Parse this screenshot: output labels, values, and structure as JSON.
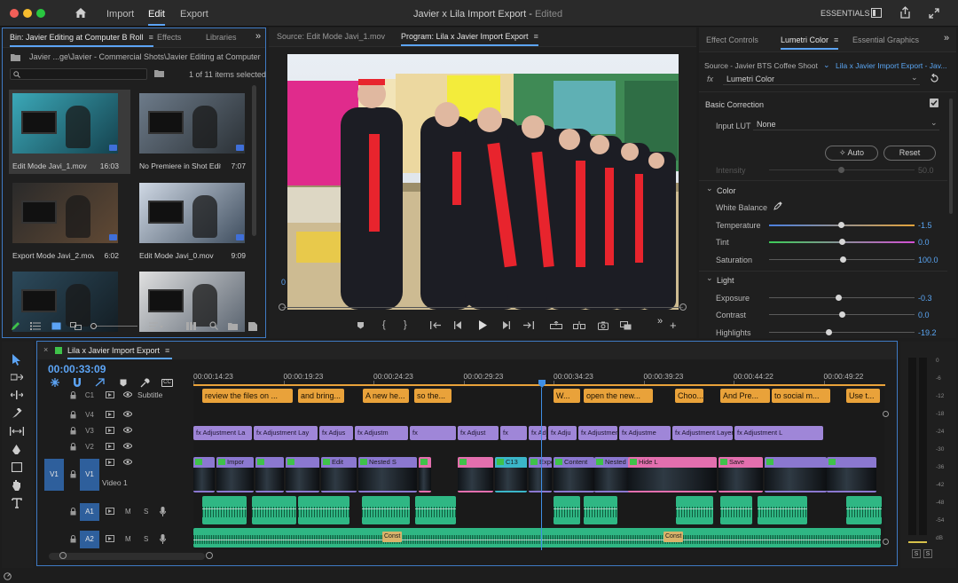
{
  "app": {
    "window_title": "Javier x Lila Import Export",
    "edited_state": "Edited",
    "nav": [
      "Import",
      "Edit",
      "Export"
    ],
    "active_nav": "Edit",
    "workspace": "ESSENTIALS"
  },
  "project_panel": {
    "tabs": [
      "Bin: Javier Editing at Computer B Roll",
      "Effects",
      "Libraries"
    ],
    "path": "Javier ...ge\\Javier - Commercial Shots\\Javier Editing at Computer B Roll",
    "search_placeholder": "",
    "selection_count": "1 of 11 items selected",
    "items": [
      {
        "name": "Edit Mode Javi_1.mov",
        "duration": "16:03",
        "selected": true
      },
      {
        "name": "No Premiere in Shot Editi...",
        "duration": "7:07",
        "selected": false
      },
      {
        "name": "Export Mode Javi_2.mov",
        "duration": "6:02",
        "selected": false
      },
      {
        "name": "Edit Mode Javi_0.mov",
        "duration": "9:09",
        "selected": false
      },
      {
        "name": "",
        "duration": "",
        "selected": false
      },
      {
        "name": "",
        "duration": "",
        "selected": false
      }
    ]
  },
  "source_monitor": {
    "tab": "Source: Edit Mode Javi_1.mov"
  },
  "program_monitor": {
    "tab": "Program: Lila x Javier Import Export",
    "partial_label": "0"
  },
  "effect_panel": {
    "tabs": [
      "Effect Controls",
      "Lumetri Color",
      "Essential Graphics"
    ],
    "active_tab": "Lumetri Color",
    "source": "Source - Javier BTS Coffee Shoot...",
    "target": "Lila x Javier Import Export - Jav...",
    "effect": "Lumetri Color",
    "basic_correction": "Basic Correction",
    "input_lut_label": "Input LUT",
    "input_lut_value": "None",
    "auto_label": "Auto",
    "reset_label": "Reset",
    "intensity": {
      "label": "Intensity",
      "value": "50.0"
    },
    "color_section": "Color",
    "white_balance": "White Balance",
    "temperature": {
      "label": "Temperature",
      "value": "-1.5"
    },
    "tint": {
      "label": "Tint",
      "value": "0.0"
    },
    "saturation": {
      "label": "Saturation",
      "value": "100.0"
    },
    "light_section": "Light",
    "exposure": {
      "label": "Exposure",
      "value": "-0.3"
    },
    "contrast": {
      "label": "Contrast",
      "value": "0.0"
    },
    "highlights": {
      "label": "Highlights",
      "value": "-19.2"
    }
  },
  "timeline": {
    "sequence_name": "Lila x Javier Import Export",
    "timecode": "00:00:33:09",
    "ruler": [
      "00:00:14:23",
      "00:00:19:23",
      "00:00:24:23",
      "00:00:29:23",
      "00:00:34:23",
      "00:00:39:23",
      "00:00:44:22",
      "00:00:49:22"
    ],
    "tracks": {
      "c1": {
        "id": "C1",
        "name": "Subtitle"
      },
      "v4": "V4",
      "v3": "V3",
      "v2": "V2",
      "v1": {
        "src": "V1",
        "id": "V1",
        "name": "Video 1"
      },
      "a1": "A1",
      "a2": "A2",
      "m": "M",
      "s": "S"
    },
    "subtitles": [
      "review the files on ...",
      "and bring...",
      "A new he...",
      "so the...",
      "W...",
      "open the new...",
      "Choo...",
      "And Pre...",
      "to social m...",
      "Use t..."
    ],
    "v3_clips": [
      "Adjustment La",
      "Adjustment Lay",
      "Adjus",
      "Adjustm",
      "",
      "Adjust",
      "",
      "Adju",
      "Adju",
      "Adjustment L",
      "Adjustme",
      "Adjustment Layer",
      "Adjustment L"
    ],
    "v1_clips": [
      "",
      "Impor",
      "",
      "",
      "Edit",
      "Nested S",
      "",
      "",
      "C13",
      "Expo",
      "Content",
      "Nested S",
      "Hide L",
      "Save"
    ],
    "a2_labels": [
      "Const",
      "Const"
    ]
  },
  "audio_meter": {
    "scale": [
      "0",
      "-6",
      "-12",
      "-18",
      "-24",
      "-30",
      "-36",
      "-42",
      "-48",
      "-54",
      "dB"
    ],
    "solo_labels": [
      "S",
      "S"
    ]
  },
  "colors": {
    "accent": "#5ca4f5",
    "subtitle": "#e9a23a",
    "adjustment": "#9f86d8",
    "video_clip": "#8b78d0",
    "pink_clip": "#e36fae",
    "audio": "#2fb784",
    "playhead": "#3f8fe6"
  }
}
